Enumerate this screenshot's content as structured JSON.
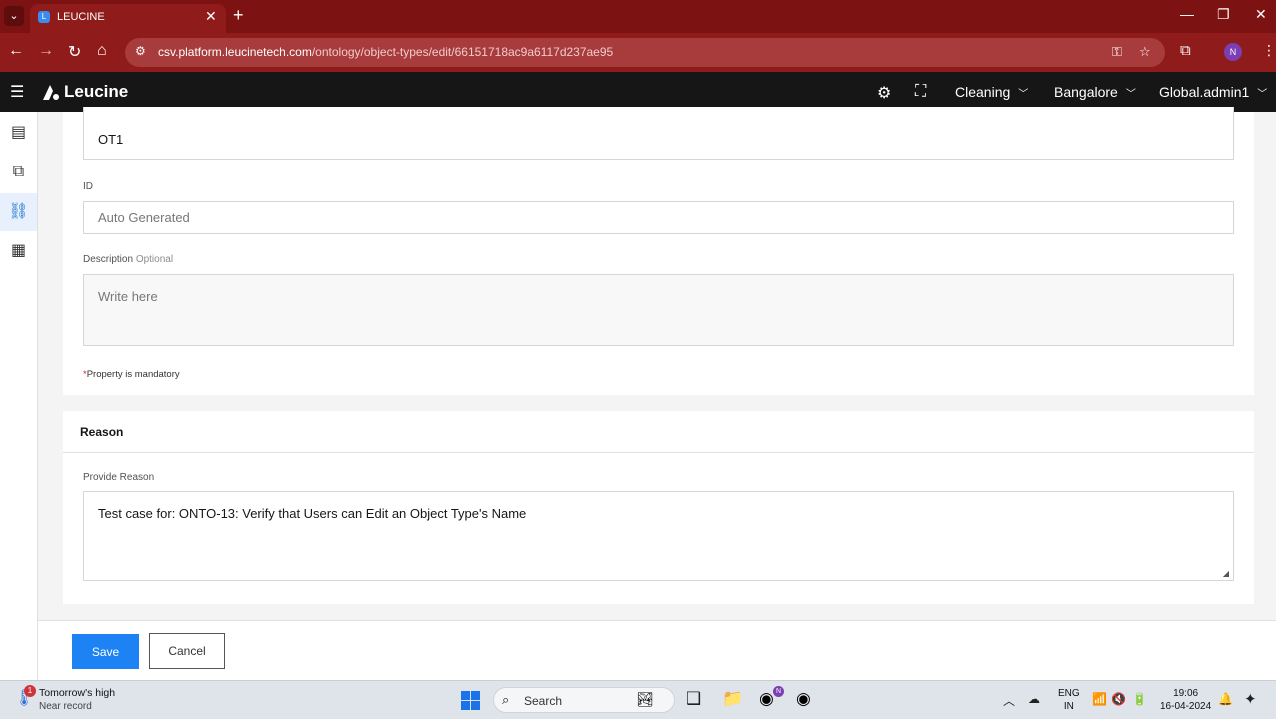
{
  "browser": {
    "tab_title": "LEUCINE",
    "tab_favicon": "L",
    "url_host": "csv.platform.leucinetech.com",
    "url_path": "/ontology/object-types/edit/66151718ac9a6117d237ae95",
    "profile_initial": "N"
  },
  "header": {
    "logo": "Leucine",
    "facility": "Cleaning",
    "site": "Bangalore",
    "user": "Global.admin1"
  },
  "form": {
    "name_value": "OT1",
    "id_label": "ID",
    "id_placeholder": "Auto Generated",
    "description_label": "Description",
    "description_optional": "Optional",
    "description_placeholder": "Write here",
    "mandatory_star": "*",
    "mandatory_note": "Property is mandatory"
  },
  "reason": {
    "title": "Reason",
    "label": "Provide Reason",
    "value": "Test case for: ONTO-13: Verify that Users can Edit an Object Type's Name"
  },
  "footer": {
    "save_label": "Save",
    "cancel_label": "Cancel"
  },
  "taskbar": {
    "weather_badge": "1",
    "weather_line1": "Tomorrow's high",
    "weather_line2": "Near record",
    "search_label": "Search",
    "lang1": "ENG",
    "lang2": "IN",
    "time": "19:06",
    "date": "16-04-2024",
    "chrome_badge": "N"
  }
}
